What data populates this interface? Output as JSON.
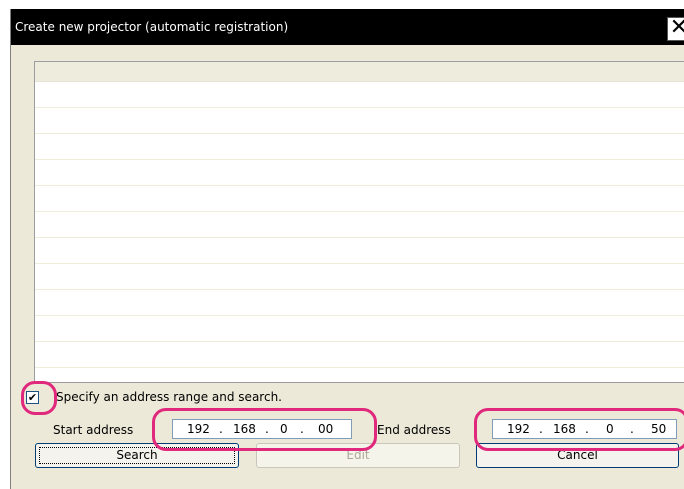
{
  "window": {
    "title": "Create new projector (automatic registration)",
    "close_glyph": "✕"
  },
  "options": {
    "specify_range_label": "Specify an address range and search.",
    "specify_range_checked": true,
    "check_glyph": "✔"
  },
  "start_address": {
    "label": "Start address",
    "octets": [
      "192",
      "168",
      "0",
      "00"
    ]
  },
  "end_address": {
    "label": "End address",
    "octets": [
      "192",
      "168",
      "0",
      "50"
    ]
  },
  "ip_separator": ".",
  "buttons": {
    "search": "Search",
    "edit": "Edit",
    "cancel": "Cancel"
  },
  "colors": {
    "highlight": "#e0287c",
    "titlebar": "#000000",
    "dialog_bg": "#ece9d8"
  },
  "list": {
    "rows": 11
  }
}
